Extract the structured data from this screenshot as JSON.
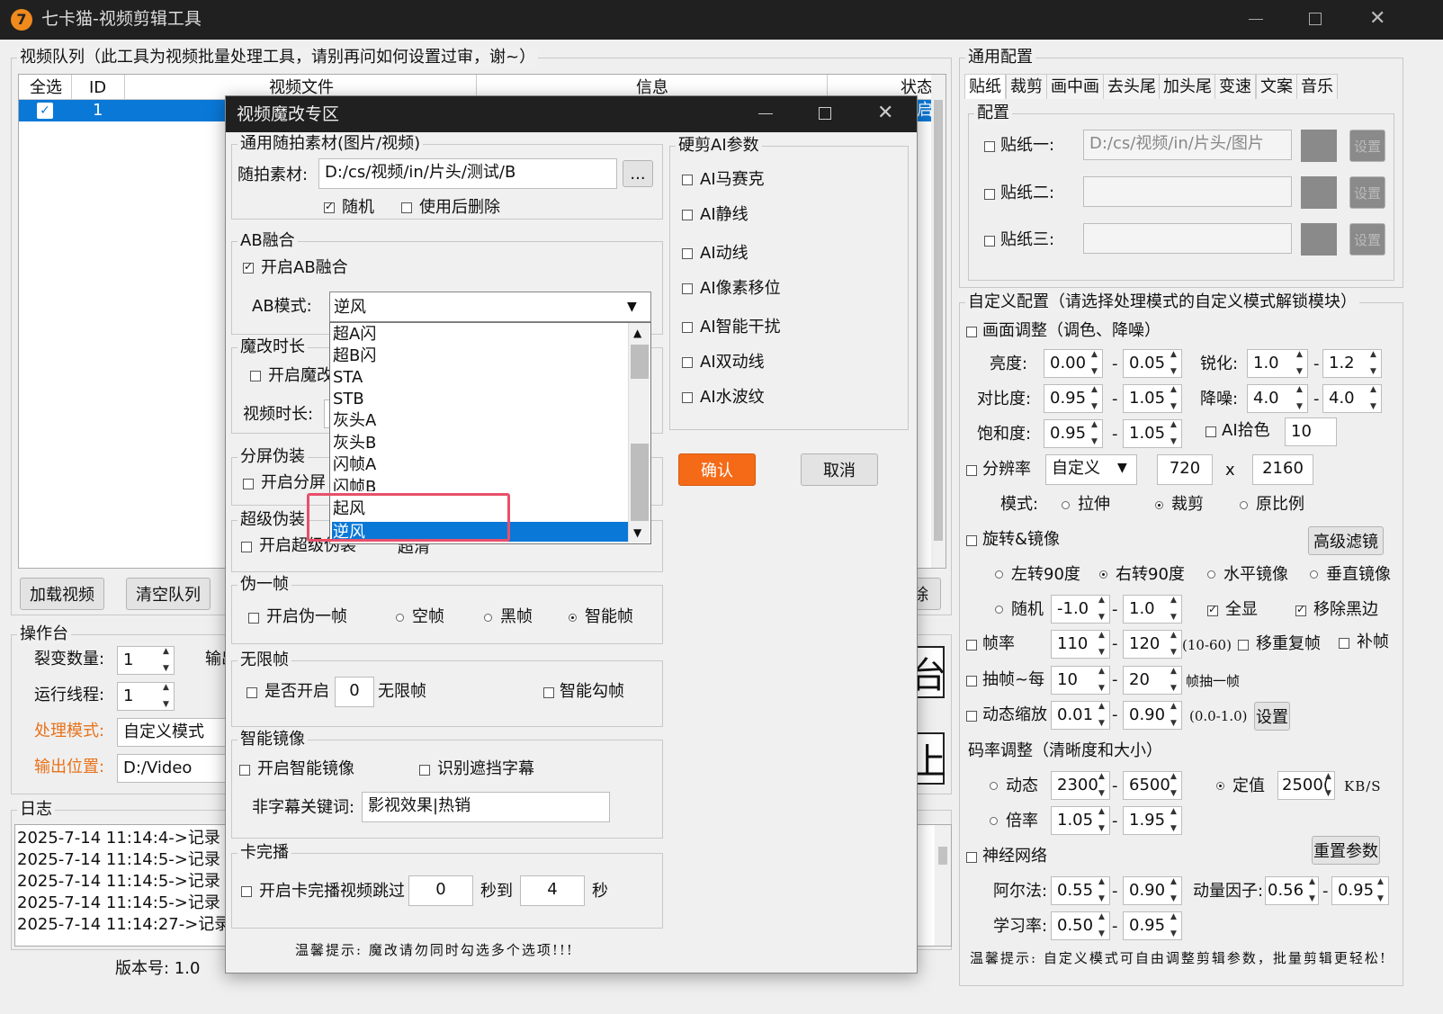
{
  "window": {
    "title": "七卡猫-视频剪辑工具",
    "icon_text": "7"
  },
  "queue": {
    "group_label": "视频队列（此工具为视频批量处理工具，请别再问如何设置过审，谢~）",
    "cols": [
      "全选",
      "ID",
      "视频文件",
      "信息",
      "状态"
    ],
    "row_id": "1",
    "status_frag": "启",
    "load_btn": "加载视频",
    "clear_btn": "清空队列",
    "remove_frag": "除"
  },
  "console": {
    "label": "操作台",
    "split_label": "裂变数量:",
    "split_val": "1",
    "thread_label": "运行线程:",
    "thread_val": "1",
    "out_frag": "输出",
    "mode_label": "处理模式:",
    "mode_val": "自定义模式",
    "outpos_label": "输出位置:",
    "outpos_val": "D:/Video",
    "big1": "台",
    "big2": "上"
  },
  "log": {
    "label": "日志",
    "lines": [
      "2025-7-14 11:14:4->记录【",
      "2025-7-14 11:14:5->记录【",
      "2025-7-14 11:14:5->记录【",
      "2025-7-14 11:14:5->记录【",
      "2025-7-14 11:14:27->记录"
    ]
  },
  "version": "版本号: 1.0",
  "general": {
    "label": "通用配置",
    "tabs": [
      "贴纸",
      "裁剪",
      "画中画",
      "去头尾",
      "加头尾",
      "变速",
      "文案",
      "音乐"
    ],
    "config_label": "配置",
    "stickers": [
      {
        "label": "贴纸一:",
        "path": "D:/cs/视频/in/片头/图片",
        "btn": "设置"
      },
      {
        "label": "贴纸二:",
        "path": "",
        "btn": "设置"
      },
      {
        "label": "贴纸三:",
        "path": "",
        "btn": "设置"
      }
    ]
  },
  "custom": {
    "label": "自定义配置（请选择处理模式的自定义模式解锁模块）",
    "picture": "画面调整（调色、降噪）",
    "brightness": {
      "label": "亮度:",
      "a": "0.00",
      "b": "0.05"
    },
    "contrast": {
      "label": "对比度:",
      "a": "0.95",
      "b": "1.05"
    },
    "saturation": {
      "label": "饱和度:",
      "a": "0.95",
      "b": "1.05"
    },
    "sharpen": {
      "label": "锐化:",
      "a": "1.0",
      "b": "1.2"
    },
    "denoise": {
      "label": "降噪:",
      "a": "4.0",
      "b": "4.0"
    },
    "ai_color": {
      "label": "AI拾色",
      "val": "10"
    },
    "resolution": {
      "label": "分辨率",
      "mode": "自定义",
      "w": "720",
      "x": "x",
      "h": "2160",
      "mode_label": "模式:",
      "opts": [
        "拉伸",
        "裁剪",
        "原比例"
      ]
    },
    "rotate": {
      "label": "旋转&镜像",
      "adv_btn": "高级滤镜",
      "opts": [
        "左转90度",
        "右转90度",
        "水平镜像",
        "垂直镜像"
      ],
      "random": "随机",
      "ra": "-1.0",
      "rb": "1.0",
      "full": "全显",
      "remove_black": "移除黑边"
    },
    "fps": {
      "label": "帧率",
      "a": "110",
      "b": "120",
      "hint": "(10-60)",
      "dedup": "移重复帧",
      "fill": "补帧"
    },
    "drop": {
      "label": "抽帧~每",
      "a": "10",
      "b": "20",
      "hint": "帧抽一帧"
    },
    "zoom": {
      "label": "动态缩放",
      "a": "0.01",
      "b": "0.90",
      "hint": "(0.0-1.0)",
      "btn": "设置"
    },
    "bitrate": {
      "label": "码率调整（清晰度和大小）",
      "dyn": "动态",
      "da": "2300",
      "db": "6500",
      "fixed": "定值",
      "fv": "2500(",
      "unit": "KB/S",
      "rate": "倍率",
      "ra": "1.05",
      "rb": "1.95"
    },
    "neural": {
      "label": "神经网络",
      "reset": "重置参数",
      "alpha": "阿尔法:",
      "aa": "0.55",
      "ab": "0.90",
      "momentum": "动量因子:",
      "ma": "0.56",
      "mb": "0.95",
      "lr": "学习率:",
      "la": "0.50",
      "lb": "0.95"
    },
    "tip": "温馨提示: 自定义模式可自由调整剪辑参数，批量剪辑更轻松!"
  },
  "dialog": {
    "title": "视频魔改专区",
    "random_group": "通用随拍素材(图片/视频)",
    "random_label": "随拍素材:",
    "random_path": "D:/cs/视频/in/片头/测试/B",
    "browse": "...",
    "random_cb": "随机",
    "delete_cb": "使用后删除",
    "ab_group": "AB融合",
    "ab_enable": "开启AB融合",
    "ab_mode_label": "AB模式:",
    "ab_mode_val": "逆风",
    "ab_options": [
      "超A闪",
      "超B闪",
      "STA",
      "STB",
      "灰头A",
      "灰头B",
      "闪帧A",
      "闪帧B",
      "起风",
      "逆风"
    ],
    "dur_group": "魔改时长",
    "dur_enable": "开启魔改",
    "dur_label": "视频时长:",
    "split_group": "分屏伪装",
    "split_enable": "开启分屏",
    "super_group": "超级伪装",
    "super_enable": "开启超级伪装",
    "super_clear": "超清",
    "fake_group": "伪一帧",
    "fake_enable": "开启伪一帧",
    "fake_opts": [
      "空帧",
      "黑帧",
      "智能帧"
    ],
    "inf_group": "无限帧",
    "inf_enable": "是否开启",
    "inf_val": "0",
    "inf_suffix": "无限帧",
    "inf_smart": "智能勾帧",
    "mirror_group": "智能镜像",
    "mirror_enable": "开启智能镜像",
    "mirror_sub": "识别遮挡字幕",
    "mirror_kw_label": "非字幕关键词:",
    "mirror_kw": "影视效果|热销",
    "card_group": "卡完播",
    "card_enable": "开启卡完播视频跳过",
    "card_a": "0",
    "card_to": "秒到",
    "card_b": "4",
    "card_unit": "秒",
    "ai_group": "硬剪AI参数",
    "ai_opts": [
      "AI马赛克",
      "AI静线",
      "AI动线",
      "AI像素移位",
      "AI智能干扰",
      "AI双动线",
      "AI水波纹"
    ],
    "ok": "确认",
    "cancel": "取消",
    "tip": "温馨提示: 魔改请勿同时勾选多个选项!!!"
  }
}
